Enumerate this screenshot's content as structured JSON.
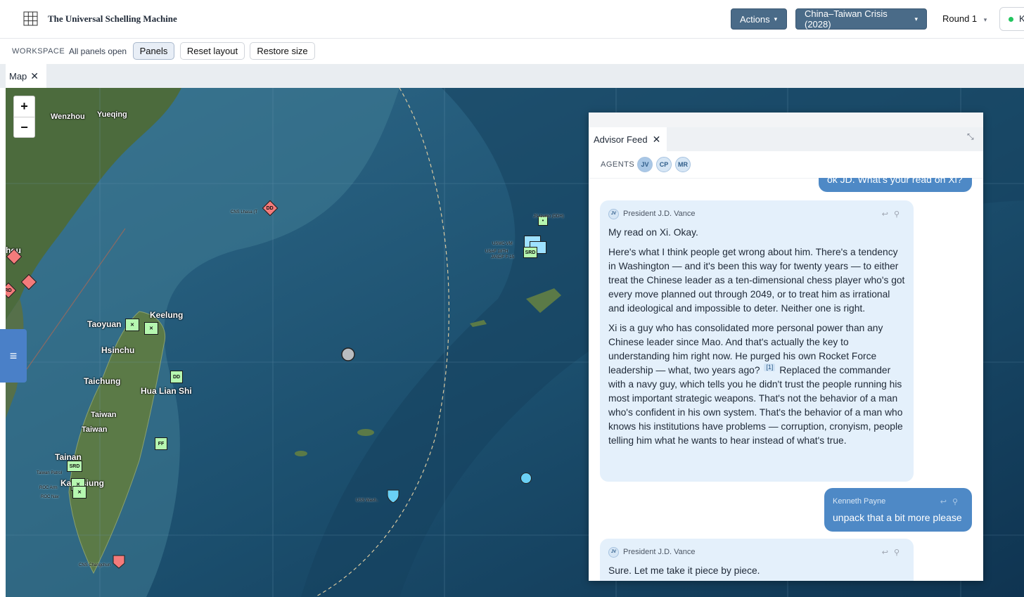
{
  "app": {
    "title": "The Universal Schelling Machine"
  },
  "header": {
    "actions_label": "Actions",
    "scenario_label": "China–Taiwan Crisis (2028)",
    "round_label": "Round 1",
    "user_initial": "K"
  },
  "workspace": {
    "label": "WORKSPACE",
    "status": "All panels open",
    "buttons": [
      "Panels",
      "Reset layout",
      "Restore size"
    ]
  },
  "tabs": {
    "map": "Map"
  },
  "map": {
    "zoom_in": "+",
    "zoom_out": "−",
    "menu_icon": "≡",
    "labels": {
      "wenzhou": "Wenzhou",
      "yueqing": "Yueqing",
      "taoyuan": "Taoyuan",
      "keelung": "Keelung",
      "hsinchu": "Hsinchu",
      "taichung": "Taichung",
      "hualien": "Hua Lian Shi",
      "taiwan1": "Taiwan",
      "taiwan2": "Taiwan",
      "tainan": "Tainan",
      "kaohsiung": "Kaohsiung",
      "fuzhou": "hou"
    },
    "units": {
      "dd_north": "DD",
      "dd_hualien": "DD",
      "ff": "FF",
      "srd_tainan": "SRD",
      "srd_okinawa": "SRD",
      "rd_west": "RD",
      "cns_lhasa": "CNS Lhasa (T",
      "uss_carrier": "USS Wash..",
      "cns_changchun": "CNS Changchun",
      "usmc": "USMC-VM",
      "usaf": "USAF 18TH",
      "jasdf": "JASDF F-15",
      "js": "JS Izumo (DDH)",
      "roc_army": "ROC Arm",
      "taiwan_patrol": "Taiwan Patrol",
      "roc_nav": "ROC Nav"
    }
  },
  "advisor": {
    "tab_label": "Advisor Feed",
    "agents_label": "AGENTS",
    "agents": [
      "JV",
      "CP",
      "MR"
    ],
    "messages": [
      {
        "type": "user",
        "text": "ok JD. What's your read on Xi?"
      },
      {
        "type": "agent",
        "initials": "JV",
        "author": "President J.D. Vance",
        "paragraphs": [
          "My read on Xi. Okay.",
          "Here's what I think people get wrong about him. There's a tendency in Washington — and it's been this way for twenty years — to either treat the Chinese leader as a ten-dimensional chess player who's got every move planned out through 2049, or to treat him as irrational and ideological and impossible to deter. Neither one is right.",
          "Xi is a guy who has consolidated more personal power than any Chinese leader since Mao. And that's actually the key to understanding him right now. He purged his own Rocket Force leadership — what, two years ago?",
          "Replaced the commander with a navy guy, which tells you he didn't trust the people running his most important strategic weapons. That's not the behavior of a man who's confident in his own system. That's the behavior of a man who knows his institutions have problems — corruption, cronyism, people telling him what he wants to hear instead of what's true."
        ],
        "citation": "[1]"
      },
      {
        "type": "user",
        "author": "Kenneth Payne",
        "text": "unpack that a bit more please"
      },
      {
        "type": "agent",
        "initials": "JV",
        "author": "President J.D. Vance",
        "paragraphs": [
          "Sure. Let me take it piece by piece."
        ]
      }
    ]
  },
  "colors": {
    "accent": "#4a6b88",
    "user_bubble": "#4e89c6",
    "agent_bubble": "#e4f0fb",
    "map_sea": "#123a55"
  }
}
